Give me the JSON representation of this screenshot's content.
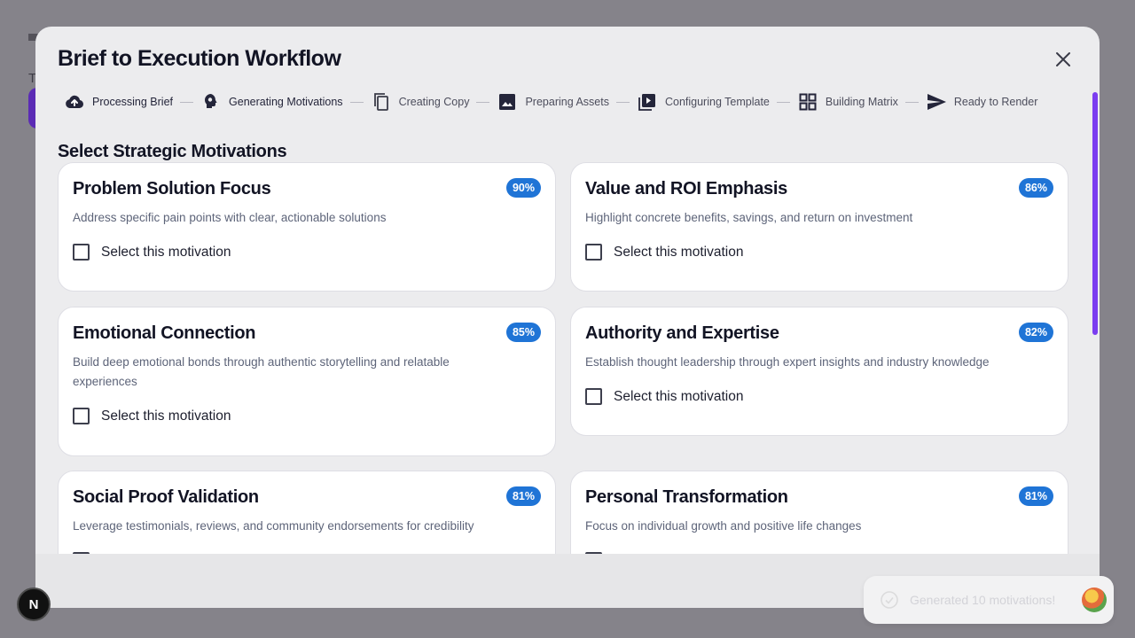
{
  "background": {
    "subtitle_char": "T"
  },
  "modal": {
    "title": "Brief to Execution Workflow",
    "steps": [
      {
        "label": "Processing Brief",
        "icon": "cloud-upload-icon",
        "state": "done"
      },
      {
        "label": "Generating Motivations",
        "icon": "brain-icon",
        "state": "active"
      },
      {
        "label": "Creating Copy",
        "icon": "copy-icon",
        "state": "pending"
      },
      {
        "label": "Preparing Assets",
        "icon": "image-icon",
        "state": "pending"
      },
      {
        "label": "Configuring Template",
        "icon": "video-template-icon",
        "state": "pending"
      },
      {
        "label": "Building Matrix",
        "icon": "grid-icon",
        "state": "pending"
      },
      {
        "label": "Ready to Render",
        "icon": "send-icon",
        "state": "pending"
      }
    ],
    "section_title": "Select Strategic Motivations",
    "checkbox_label": "Select this motivation",
    "motivations": [
      {
        "title": "Problem Solution Focus",
        "score": "90%",
        "description": "Address specific pain points with clear, actionable solutions",
        "selected": false
      },
      {
        "title": "Value and ROI Emphasis",
        "score": "86%",
        "description": "Highlight concrete benefits, savings, and return on investment",
        "selected": false
      },
      {
        "title": "Emotional Connection",
        "score": "85%",
        "description": "Build deep emotional bonds through authentic storytelling and relatable experiences",
        "selected": false
      },
      {
        "title": "Authority and Expertise",
        "score": "82%",
        "description": "Establish thought leadership through expert insights and industry knowledge",
        "selected": false
      },
      {
        "title": "Social Proof Validation",
        "score": "81%",
        "description": "Leverage testimonials, reviews, and community endorsements for credibility",
        "selected": false
      },
      {
        "title": "Personal Transformation",
        "score": "81%",
        "description": "Focus on individual growth and positive life changes",
        "selected": false
      }
    ]
  },
  "toast": {
    "message": "Generated 10 motivations!"
  },
  "dev_badge": {
    "letter": "N"
  },
  "colors": {
    "accent_purple": "#7b3df0",
    "badge_blue": "#1f74d6",
    "overlay": "#85838a"
  }
}
